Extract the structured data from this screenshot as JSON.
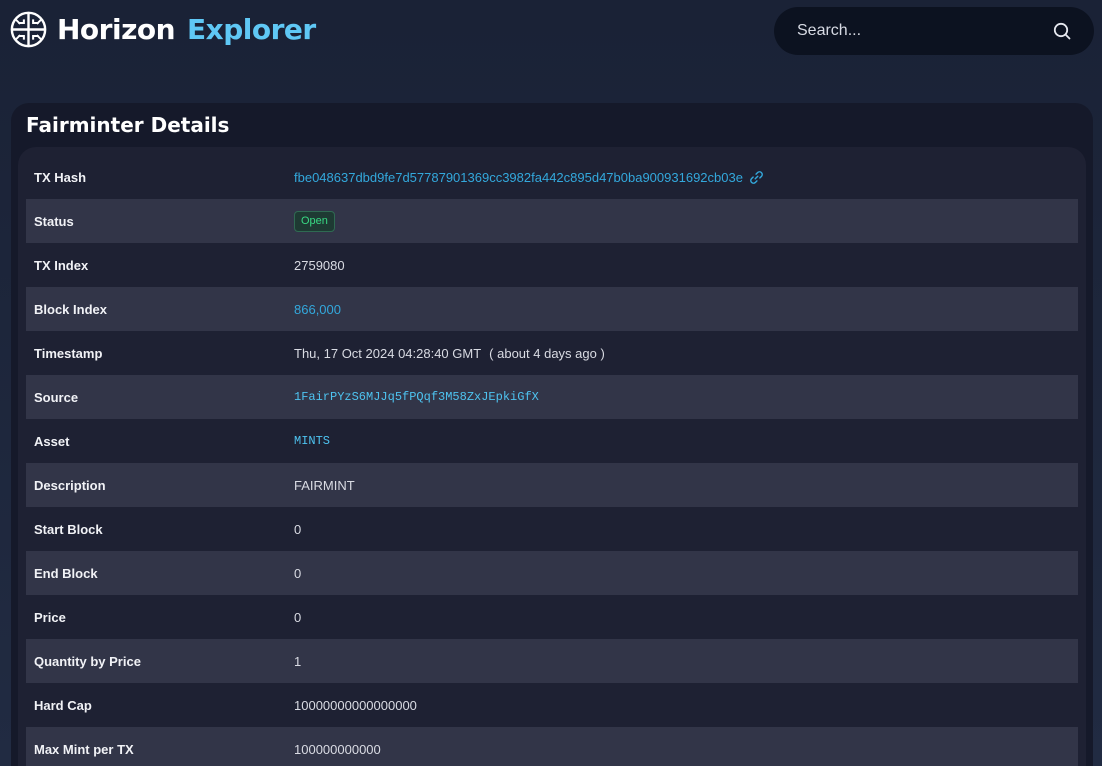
{
  "header": {
    "brand_primary": "Horizon",
    "brand_secondary": "Explorer",
    "logo_icon": "horizon-logo-icon",
    "search_placeholder": "Search...",
    "search_icon": "search-icon"
  },
  "colors": {
    "background": "#1a2236",
    "card": "#15192a",
    "accent": "#5fc8f5",
    "link": "#33a8dc",
    "status_open": "#39d883"
  },
  "details": {
    "title": "Fairminter Details",
    "rows": [
      {
        "label": "TX Hash",
        "value": "fbe048637dbd9fe7d57787901369cc3982fa442c895d47b0ba900931692cb03e"
      },
      {
        "label": "Status",
        "value": "Open"
      },
      {
        "label": "TX Index",
        "value": "2759080"
      },
      {
        "label": "Block Index",
        "value": "866,000"
      },
      {
        "label": "Timestamp",
        "value": "Thu, 17 Oct 2024 04:28:40 GMT",
        "relative": "( about 4 days ago )"
      },
      {
        "label": "Source",
        "value": "1FairPYzS6MJJq5fPQqf3M58ZxJEpkiGfX"
      },
      {
        "label": "Asset",
        "value": "MINTS"
      },
      {
        "label": "Description",
        "value": "FAIRMINT"
      },
      {
        "label": "Start Block",
        "value": "0"
      },
      {
        "label": "End Block",
        "value": "0"
      },
      {
        "label": "Price",
        "value": "0"
      },
      {
        "label": "Quantity by Price",
        "value": "1"
      },
      {
        "label": "Hard Cap",
        "value": "10000000000000000"
      },
      {
        "label": "Max Mint per TX",
        "value": "100000000000"
      }
    ]
  }
}
